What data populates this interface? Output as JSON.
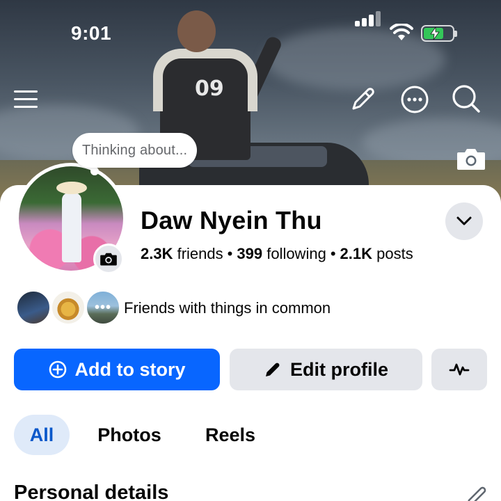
{
  "status_bar": {
    "time": "9:01",
    "battery_state": "charging",
    "battery_color": "#34c759"
  },
  "header_icons": [
    "menu-icon",
    "pencil-icon",
    "more-icon",
    "search-icon",
    "camera-icon"
  ],
  "profile": {
    "thought_bubble": "Thinking about...",
    "name": "Daw Nyein Thu",
    "stats": {
      "friends_count": "2.3K",
      "friends_label": "friends",
      "following_count": "399",
      "following_label": "following",
      "posts_count": "2.1K",
      "posts_label": "posts",
      "separator": "•"
    },
    "mutual_text": "Friends with things in common"
  },
  "actions": {
    "add_story": "Add to story",
    "edit_profile": "Edit profile"
  },
  "tabs": [
    {
      "label": "All",
      "active": true
    },
    {
      "label": "Photos",
      "active": false
    },
    {
      "label": "Reels",
      "active": false
    }
  ],
  "section": {
    "title": "Personal details"
  },
  "colors": {
    "primary": "#0866ff",
    "secondary_button": "#e4e6eb",
    "active_tab_bg": "#dfeaf9",
    "active_tab_text": "#0a58ca"
  }
}
